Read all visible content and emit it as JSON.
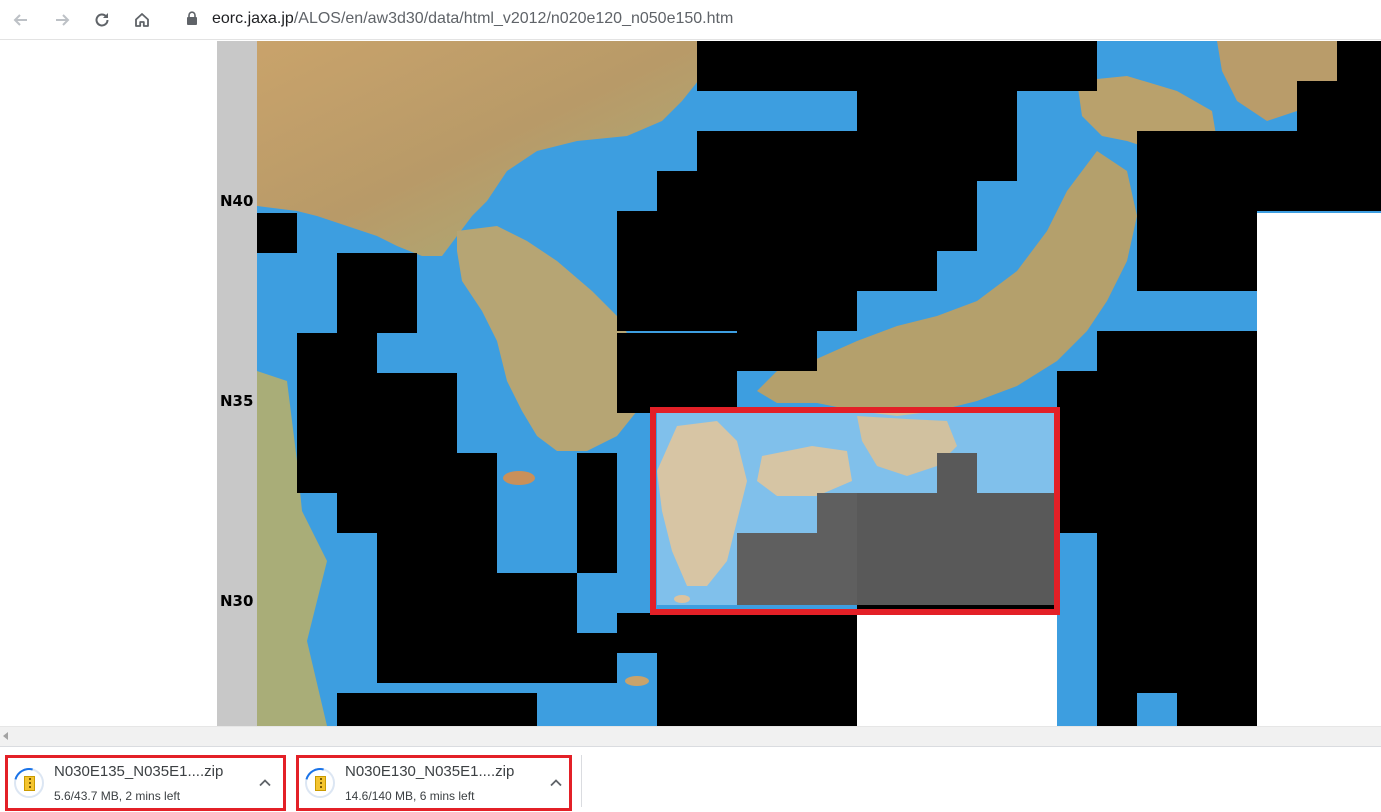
{
  "browser": {
    "url_host": "eorc.jaxa.jp",
    "url_path": "/ALOS/en/aw3d30/data/html_v2012/n020e120_n050e150.htm",
    "icons": [
      "back-arrow-icon",
      "forward-arrow-icon",
      "reload-icon",
      "home-icon",
      "lock-icon"
    ]
  },
  "map": {
    "latitude_labels": [
      "N40",
      "N35",
      "N30"
    ],
    "colors": {
      "ocean": "#3d9ee0",
      "no_data": "#000000",
      "gray_strip": "#c8c8c8",
      "selection_border": "#e32027",
      "selection_overlay": "#ffffff"
    }
  },
  "downloads": [
    {
      "name": "N030E135_N035E1....zip",
      "status": "5.6/43.7 MB, 2 mins left"
    },
    {
      "name": "N030E130_N035E1....zip",
      "status": "14.6/140 MB, 6 mins left"
    }
  ]
}
